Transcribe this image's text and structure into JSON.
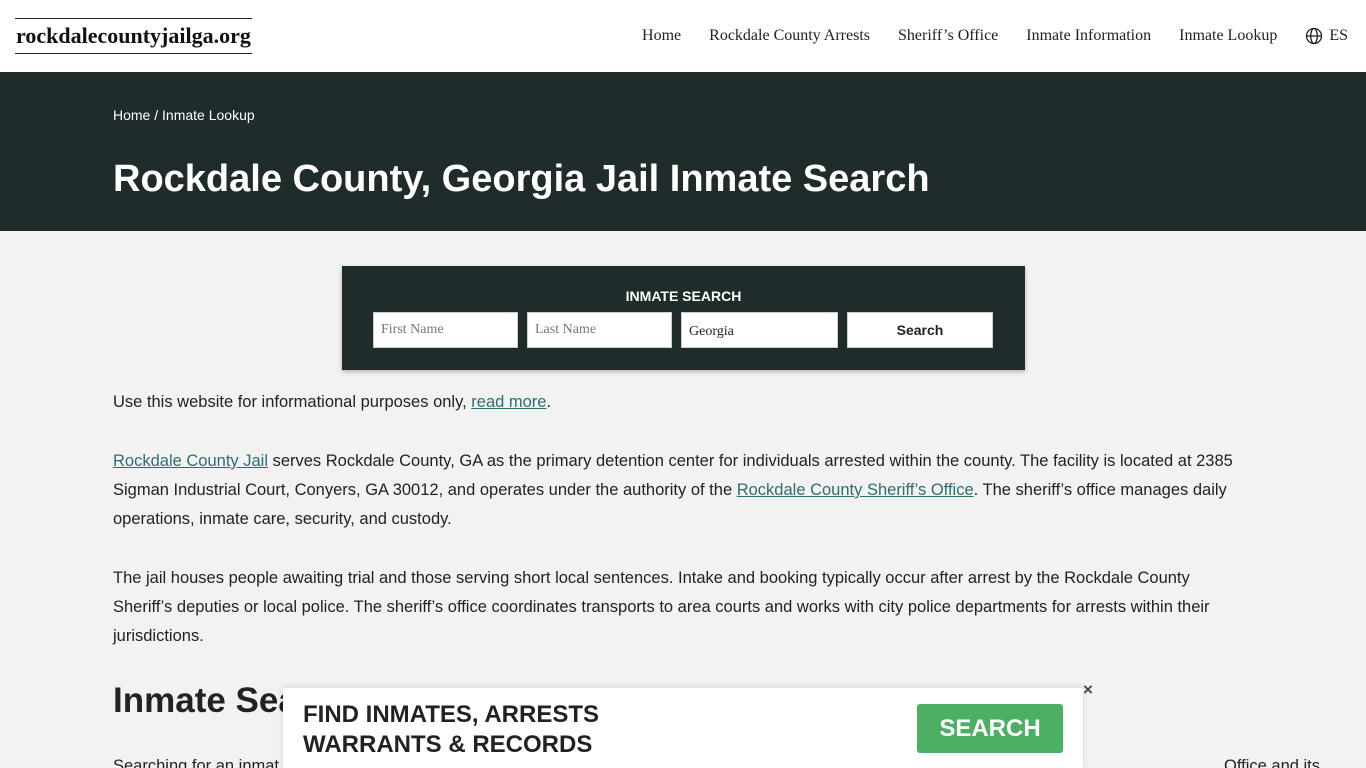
{
  "header": {
    "logo": "rockdalecountyjailga.org",
    "nav": [
      "Home",
      "Rockdale County Arrests",
      "Sheriff’s Office",
      "Inmate Information",
      "Inmate Lookup"
    ],
    "lang": "ES"
  },
  "hero": {
    "breadcrumb_home": "Home",
    "breadcrumb_sep": " / ",
    "breadcrumb_current": "Inmate Lookup",
    "title": "Rockdale County, Georgia Jail Inmate Search"
  },
  "search": {
    "title": "INMATE SEARCH",
    "first_placeholder": "First Name",
    "last_placeholder": "Last Name",
    "state_value": "Georgia",
    "button": "Search"
  },
  "content": {
    "p1_text": "Use this website for informational purposes only, ",
    "p1_link": "read more",
    "p1_end": ".",
    "p2_link1": "Rockdale County Jail",
    "p2_mid": " serves Rockdale County, GA as the primary detention center for individuals arrested within the county. The facility is located at 2385 Sigman Industrial Court, Conyers, GA 30012, and operates under the authority of the ",
    "p2_link2": "Rockdale County Sheriff’s Office",
    "p2_end": ". The sheriff’s office manages daily operations, inmate care, security, and custody.",
    "p3": "The jail houses people awaiting trial and those serving short local sentences. Intake and booking typically occur after arrest by the Rockdale County Sheriff’s deputies or local police. The sheriff’s office coordinates transports to area courts and works with city police departments for arrests within their jurisdictions.",
    "h2": "Inmate Sea",
    "p4_start": "Searching for an inmat",
    "p4_end": "Office and its"
  },
  "ad": {
    "line1": "FIND INMATES, ARRESTS",
    "line2": "WARRANTS & RECORDS",
    "button": "SEARCH",
    "close": "×"
  }
}
